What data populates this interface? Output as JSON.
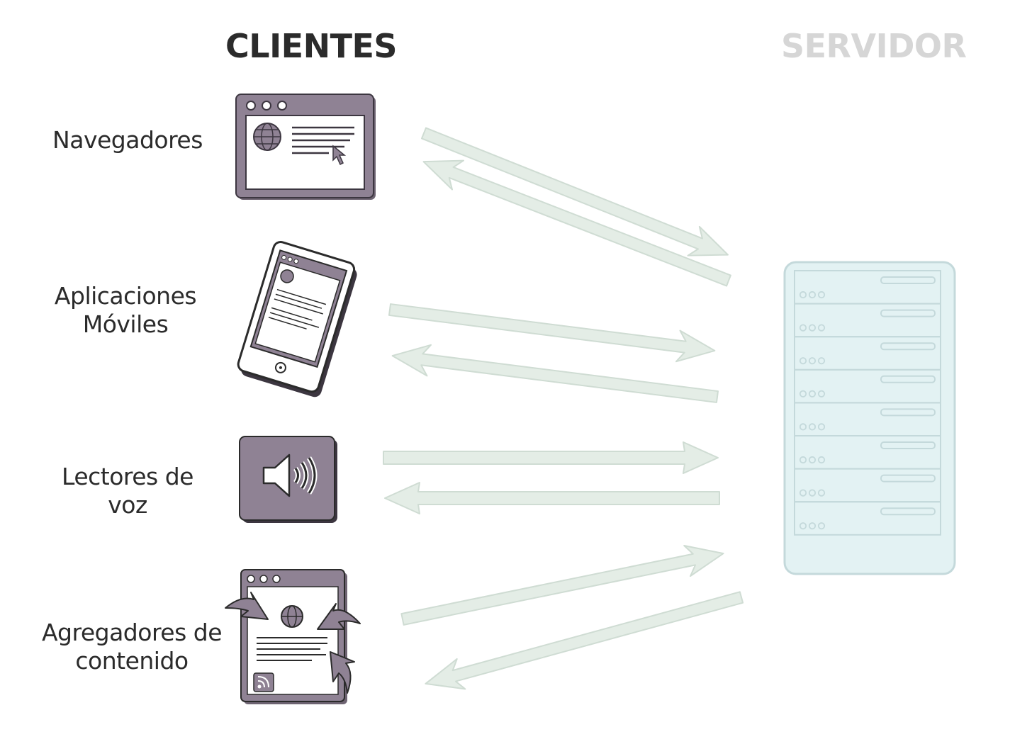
{
  "headers": {
    "clients": "CLIENTES",
    "server": "SERVIDOR"
  },
  "clients": [
    {
      "lines": [
        "Navegadores"
      ],
      "icon": "browser-window-icon"
    },
    {
      "lines": [
        "Aplicaciones",
        "Móviles"
      ],
      "icon": "tablet-icon"
    },
    {
      "lines": [
        "Lectores de voz"
      ],
      "icon": "speaker-icon"
    },
    {
      "lines": [
        "Agregadores de",
        "contenido"
      ],
      "icon": "rss-feed-document-icon"
    }
  ],
  "server": {
    "icon": "server-rack-icon",
    "units": 8
  },
  "colors": {
    "device": "#8f8294",
    "device_light": "#b6acb9",
    "arrow_fill": "#e4ede6",
    "arrow_stroke": "#cfdcd3",
    "server_fill": "#e3f2f3",
    "server_stroke": "#c4d9db",
    "heading_dark": "#2b2b2b",
    "heading_light": "#d6d6d6"
  }
}
